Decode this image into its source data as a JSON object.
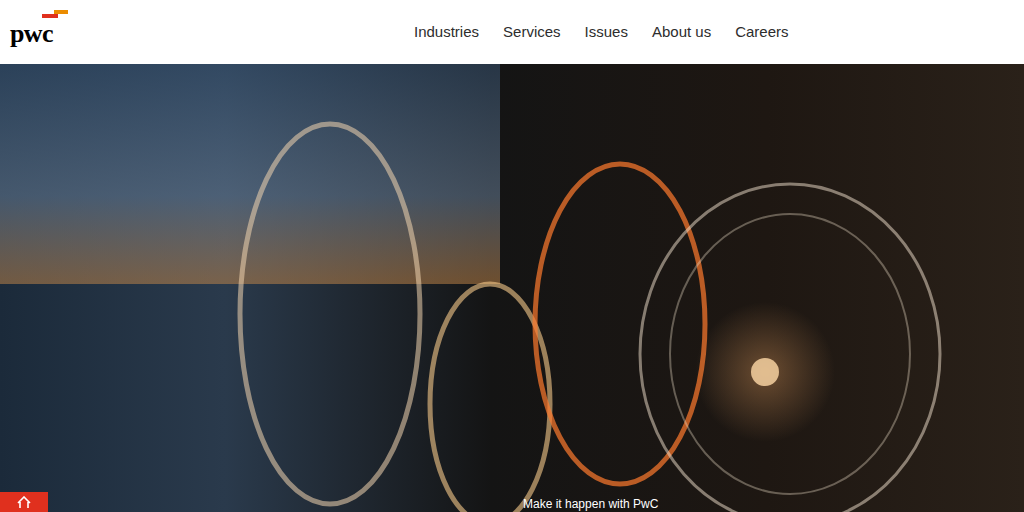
{
  "header": {
    "logo": "pwc",
    "nav": [
      {
        "label": "Industries"
      },
      {
        "label": "Services"
      },
      {
        "label": "Issues"
      },
      {
        "label": "About us"
      },
      {
        "label": "Careers"
      }
    ]
  },
  "hero": {
    "caption": "Make it happen with PwC"
  }
}
